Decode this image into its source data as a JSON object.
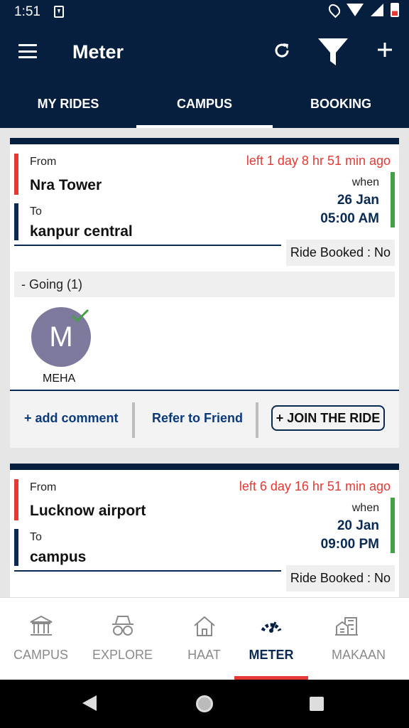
{
  "status_bar": {
    "time": "1:51"
  },
  "app_bar": {
    "title": "Meter"
  },
  "tabs": [
    {
      "label": "MY RIDES"
    },
    {
      "label": "CAMPUS"
    },
    {
      "label": "BOOKING"
    }
  ],
  "active_tab": "CAMPUS",
  "rides": [
    {
      "from_label": "From",
      "from": "Nra Tower",
      "to_label": "To",
      "to": "kanpur central",
      "left_ago": "left 1 day 8 hr 51 min ago",
      "when_label": "when",
      "date": "26 Jan",
      "time": "05:00 AM",
      "ride_booked": "Ride Booked : No",
      "going": "- Going (1)",
      "participants": [
        {
          "initial": "M",
          "name": "MEHA"
        }
      ],
      "actions": {
        "add_comment": "+ add comment",
        "refer": "Refer to Friend",
        "join": "+ JOIN THE RIDE"
      }
    },
    {
      "from_label": "From",
      "from": "Lucknow airport",
      "to_label": "To",
      "to": "campus",
      "left_ago": "left 6 day 16 hr 51 min ago",
      "when_label": "when",
      "date": "20 Jan",
      "time": "09:00 PM",
      "ride_booked": "Ride Booked : No"
    }
  ],
  "bottom_nav": [
    {
      "label": "CAMPUS",
      "icon": "campus-icon"
    },
    {
      "label": "EXPLORE",
      "icon": "explore-icon"
    },
    {
      "label": "HAAT",
      "icon": "home-icon"
    },
    {
      "label": "METER",
      "icon": "meter-icon",
      "active": true
    },
    {
      "label": "MAKAAN",
      "icon": "makaan-icon"
    }
  ],
  "colors": {
    "primary": "#061f3f",
    "accent_red": "#e53935",
    "accent_green": "#43a047",
    "link_blue": "#0b3a7a"
  }
}
